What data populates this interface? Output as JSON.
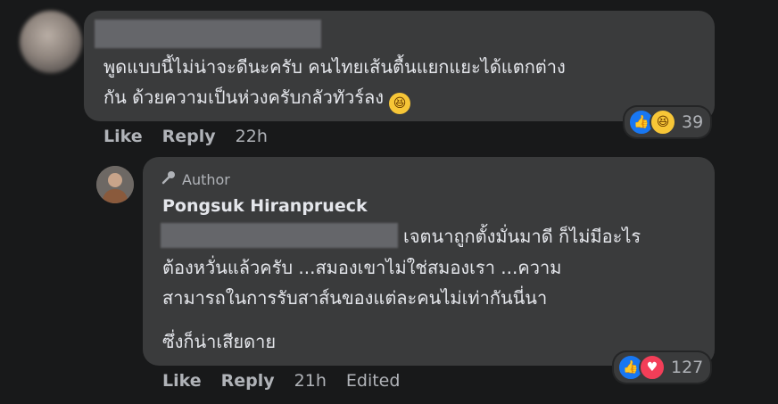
{
  "comment_1": {
    "text_line_1": "พูดแบบนี้ไม่น่าจะดีนะครับ คนไทยเส้นตื้นแยกแยะได้แตกต่าง",
    "text_line_2": "กัน ด้วยความเป็นห่วงครับกลัวทัวร์ลง",
    "emoji": "😆",
    "reaction_count": "39",
    "actions": {
      "like": "Like",
      "reply": "Reply",
      "time": "22h"
    }
  },
  "comment_2": {
    "badge": "Author",
    "name": "Pongsuk Hiranprueck",
    "text_line_1": "เจตนาถูกตั้งมั่นมาดี ก็ไม่มีอะไร",
    "text_line_2": "ต้องหวั่นแล้วครับ ...สมองเขาไม่ใช่สมองเรา ...ความ",
    "text_line_3": "สามารถในการรับสาส์นของแต่ละคนไม่เท่ากันนี่นา",
    "text_line_4": "ซึ่งก็น่าเสียดาย",
    "reaction_count": "127",
    "actions": {
      "like": "Like",
      "reply": "Reply",
      "time": "21h",
      "edited": "Edited"
    }
  }
}
